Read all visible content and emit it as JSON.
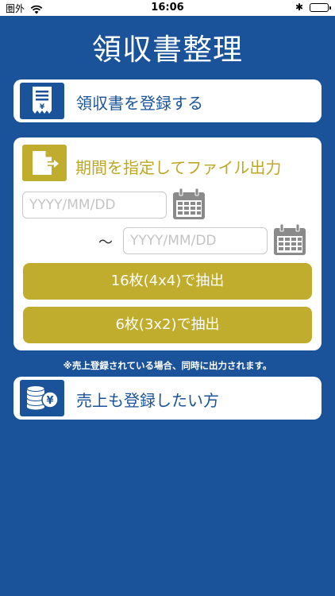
{
  "status_bar": {
    "carrier": "圏外",
    "time": "16:06",
    "bluetooth": "✱"
  },
  "title": "領収書整理",
  "register_card": {
    "label": "領収書を登録する",
    "icon": "receipt-yen-icon"
  },
  "export_card": {
    "label": "期間を指定してファイル出力",
    "icon": "file-export-icon",
    "start_date": {
      "placeholder": "YYYY/MM/DD",
      "value": ""
    },
    "separator": "〜",
    "end_date": {
      "placeholder": "YYYY/MM/DD",
      "value": ""
    },
    "calendar_icon": "calendar-icon",
    "button_16": "16枚(4x4)で抽出",
    "button_6": "6枚(3x2)で抽出"
  },
  "note": "※売上登録されている場合、同時に出力されます。",
  "sales_card": {
    "label": "売上も登録したい方",
    "icon": "coins-yen-icon"
  },
  "colors": {
    "background": "#1a5399",
    "accent_gold": "#c1ad2d",
    "card": "#ffffff"
  }
}
